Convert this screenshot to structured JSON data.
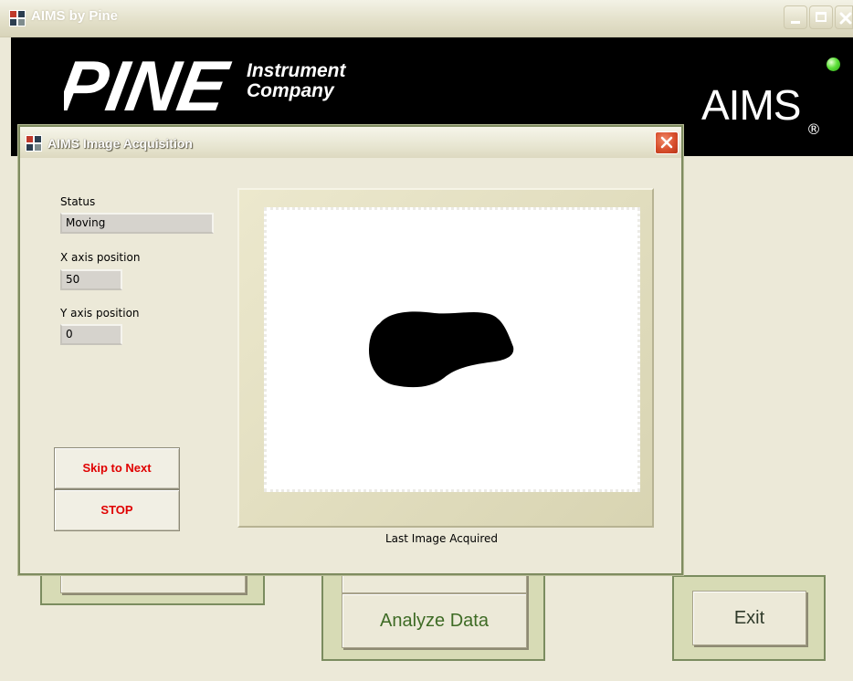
{
  "main_window": {
    "title": "AIMS by Pine"
  },
  "banner": {
    "company_logo_text": "PINE",
    "company_line1": "Instrument",
    "company_line2": "Company",
    "product_name": "AIMS",
    "registered_mark": "®",
    "status_led_color": "#4ddb2b"
  },
  "background_buttons": {
    "analyze_data_label": "Analyze Data",
    "exit_label": "Exit"
  },
  "dialog": {
    "title": "AIMS Image Acquisition",
    "status_label": "Status",
    "status_value": "Moving",
    "x_axis_label": "X axis position",
    "x_axis_value": "50",
    "y_axis_label": "Y axis position",
    "y_axis_value": "0",
    "skip_button_label": "Skip to Next",
    "stop_button_label": "STOP",
    "image_caption": "Last Image Acquired"
  },
  "colors": {
    "panel_fill": "#d7dbb5",
    "panel_border": "#7b8c5f",
    "action_text": "#e00000",
    "button_text_green": "#3e6b25",
    "close_button_red": "#d84f2c"
  },
  "icons": [
    "app-icon",
    "minimize-icon",
    "maximize-icon",
    "close-icon"
  ]
}
